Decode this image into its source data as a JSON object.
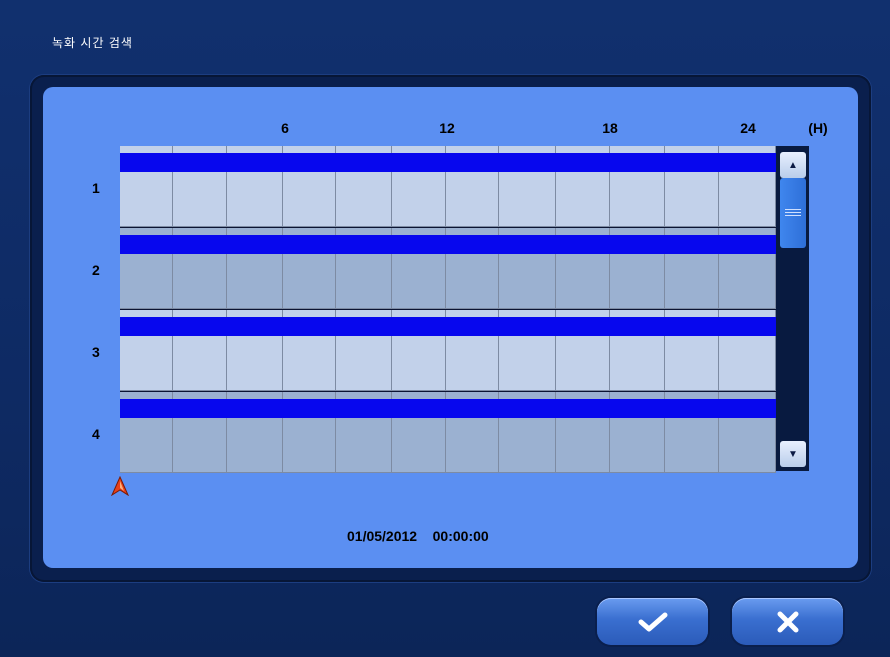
{
  "window": {
    "title": "녹화 시간 검색"
  },
  "timeline": {
    "hour_ticks": [
      "6",
      "12",
      "18",
      "24"
    ],
    "unit_label": "(H)",
    "channels": [
      {
        "label": "1",
        "recording": [
          0,
          24
        ]
      },
      {
        "label": "2",
        "recording": [
          0,
          24
        ]
      },
      {
        "label": "3",
        "recording": [
          0,
          24
        ]
      },
      {
        "label": "4",
        "recording": [
          0,
          24
        ]
      }
    ]
  },
  "status": {
    "date": "01/05/2012",
    "time": "00:00:00"
  },
  "buttons": {
    "confirm_icon": "check-icon",
    "cancel_icon": "close-icon"
  },
  "colors": {
    "recording_bar": "#0707ee",
    "panel": "#5b8ff2",
    "background": "#11306e",
    "marker": "#e8401a"
  }
}
